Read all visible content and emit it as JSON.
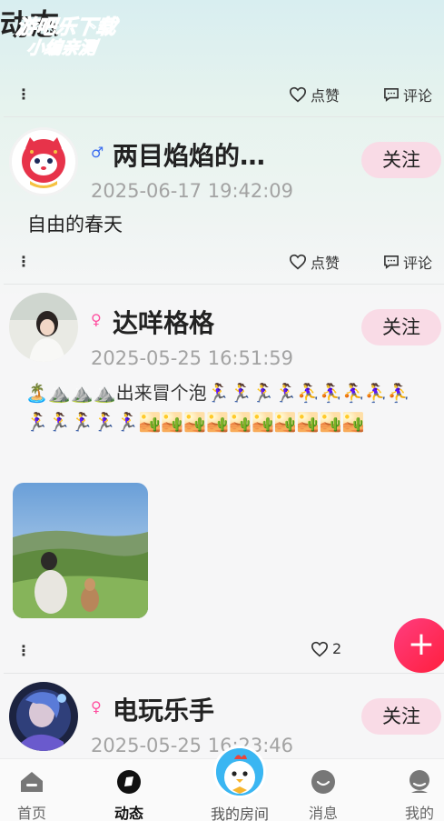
{
  "page": {
    "title": "动态"
  },
  "watermark": {
    "line1": "游吧乐下载",
    "line2": "小编亲测"
  },
  "top_actions": {
    "like_label": "点赞",
    "comment_label": "评论",
    "more_label": "⋮"
  },
  "posts": [
    {
      "username": "两目焰焰的…",
      "gender": "male",
      "gender_symbol": "♂",
      "timestamp": "2025-06-17 19:42:09",
      "follow_label": "关注",
      "content": "自由的春天",
      "actions": {
        "more_label": "⋮",
        "like_label": "点赞",
        "comment_label": "评论"
      }
    },
    {
      "username": "达咩格格",
      "gender": "female",
      "gender_symbol": "♀",
      "timestamp": "2025-05-25 16:51:59",
      "follow_label": "关注",
      "content": "🏝️⛰️⛰️⛰️出来冒个泡🏃‍♀️🏃‍♀️🏃‍♀️🏃‍♀️⛹️‍♀️⛹️‍♀️⛹️‍♀️⛹️‍♀️⛹️‍♀️🏃‍♀️🏃‍♀️🏃‍♀️🏃‍♀️🏃‍♀️🏜️🏜️🏜️🏜️🏜️🏜️🏜️🏜️🏜️🏜️",
      "actions": {
        "more_label": "⋮",
        "like_count": "2"
      }
    },
    {
      "username": "电玩乐手",
      "gender": "female",
      "gender_symbol": "♀",
      "timestamp": "2025-05-25 16:23:46",
      "follow_label": "关注"
    }
  ],
  "fab": {
    "label": "+"
  },
  "tabbar": {
    "items": [
      {
        "label": "首页",
        "icon": "home-icon",
        "active": false
      },
      {
        "label": "动态",
        "icon": "moments-icon",
        "active": true
      },
      {
        "label": "我的房间",
        "icon": "chick-avatar-icon",
        "active": false
      },
      {
        "label": "消息",
        "icon": "message-icon",
        "active": false
      },
      {
        "label": "我的",
        "icon": "profile-icon",
        "active": false
      }
    ]
  },
  "colors": {
    "follow_bg": "#f9dbe6",
    "male": "#3b6df0",
    "female": "#ff4fa0",
    "fab": "#ff2a4e",
    "timestamp": "#a3a3a3"
  }
}
